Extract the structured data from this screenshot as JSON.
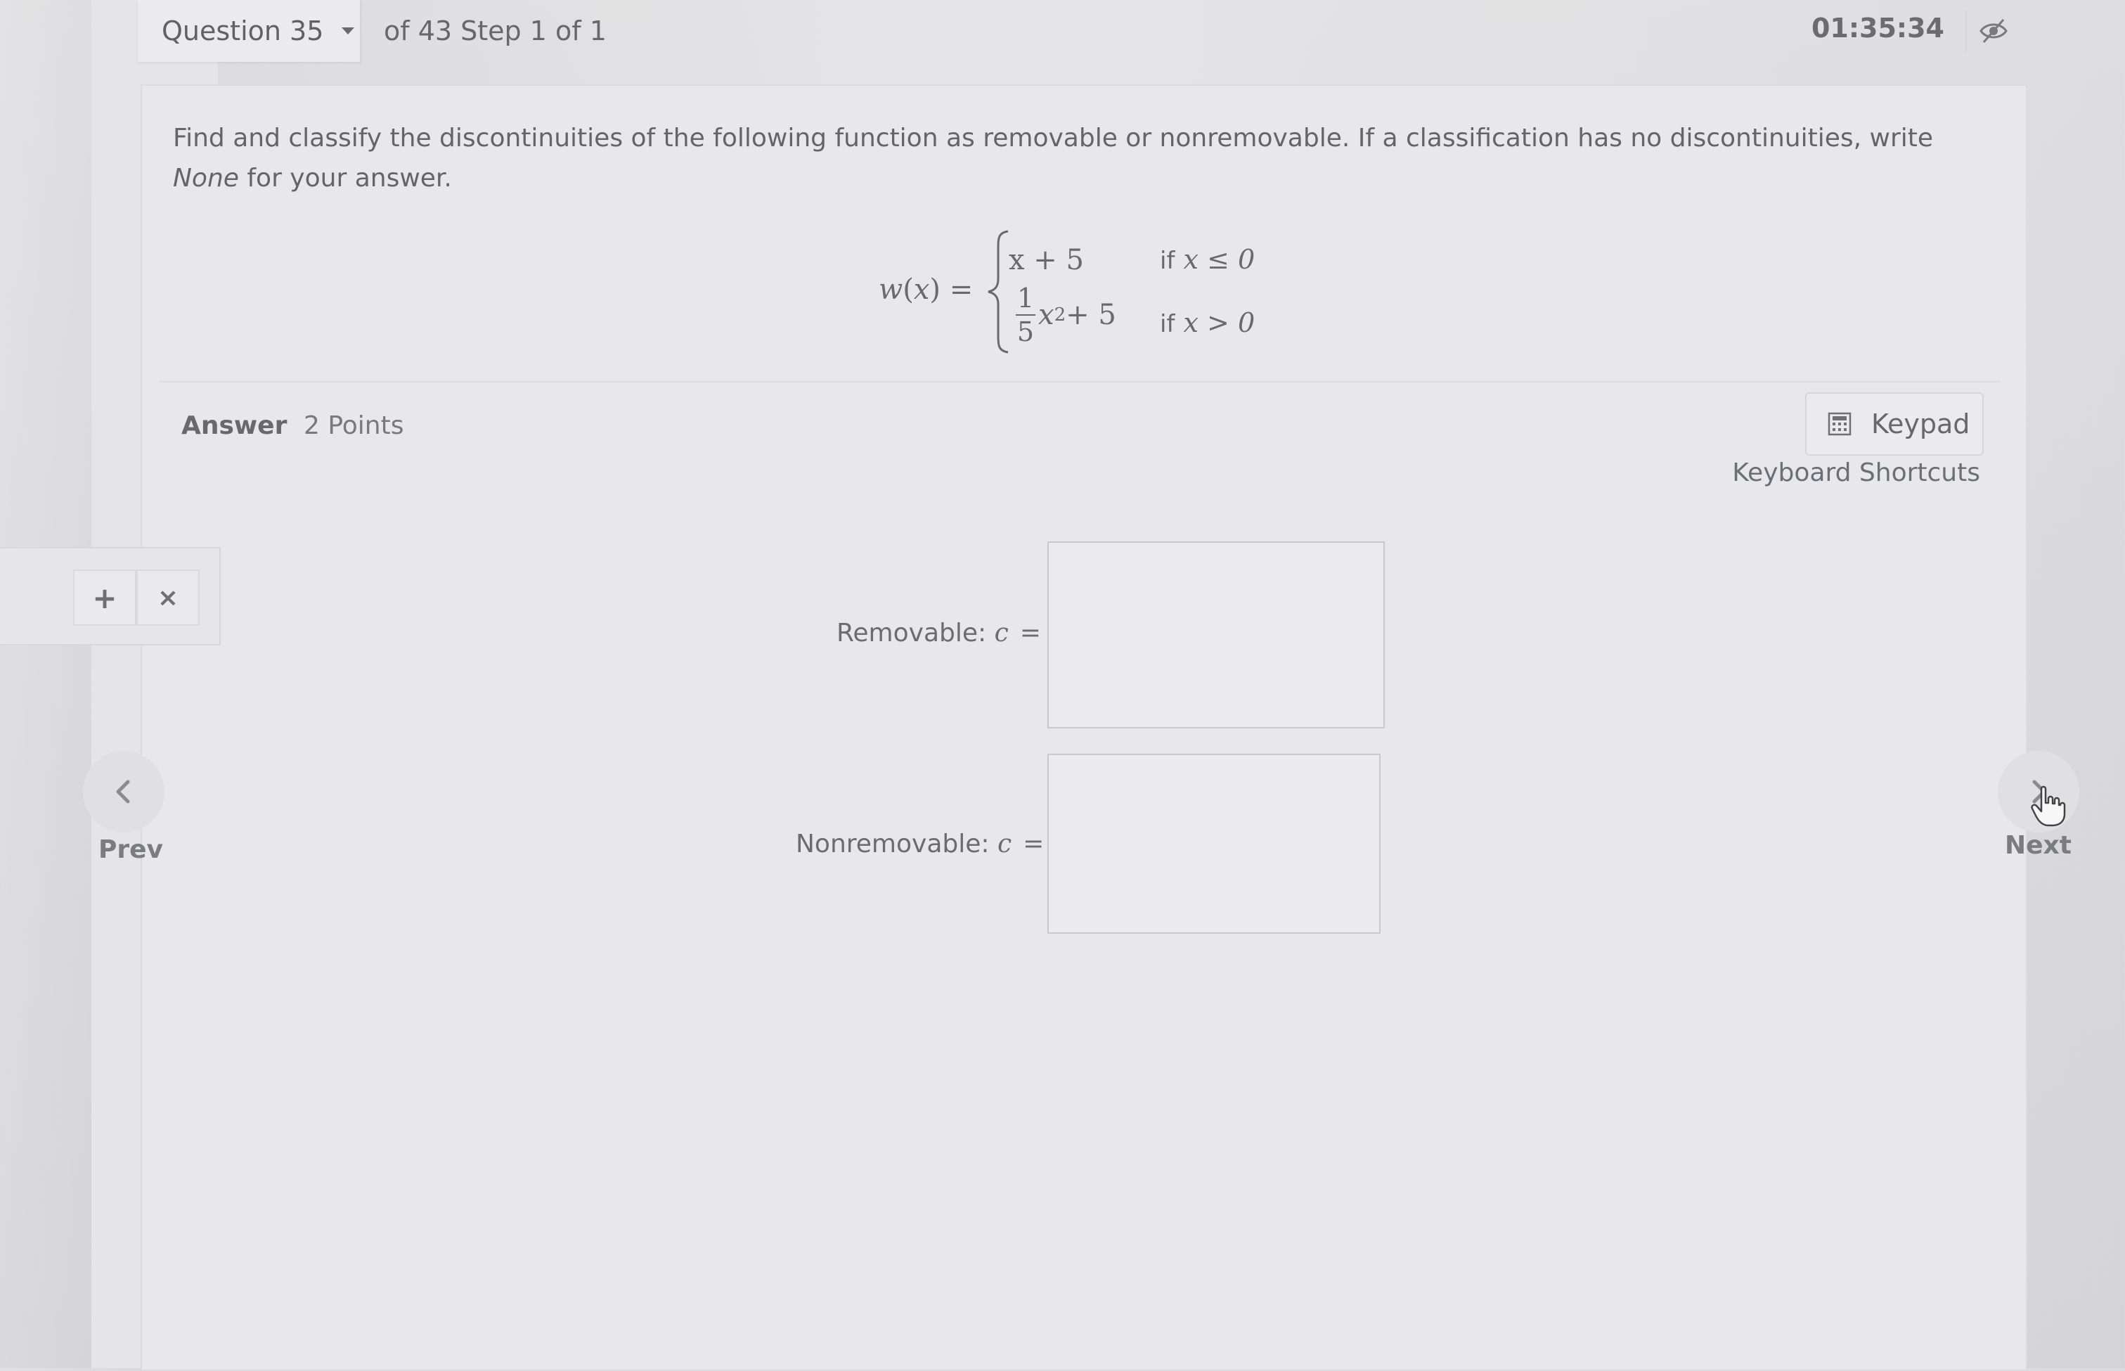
{
  "header": {
    "question_label": "Question 35",
    "step_text": "of 43 Step 1 of 1",
    "timer": "01:35:34",
    "visibility_icon": "eye-off-icon"
  },
  "prompt": {
    "text_before_none": "Find and classify the discontinuities of the following function as removable or nonremovable. If a classification has no discontinuities, write ",
    "none_word": "None",
    "text_after_none": " for your answer."
  },
  "equation": {
    "lhs_name": "w",
    "lhs_var": "x",
    "equals": "=",
    "case1_expr": "x + 5",
    "case1_if": "if",
    "case1_cond": "x ≤ 0",
    "case2_num": "1",
    "case2_den": "5",
    "case2_var": "x",
    "case2_exp": "2",
    "case2_rest": " + 5",
    "case2_if": "if",
    "case2_cond": "x > 0"
  },
  "answer": {
    "label": "Answer",
    "points": "2 Points",
    "keypad_label": "Keypad",
    "keyboard_shortcuts": "Keyboard Shortcuts",
    "removable_label": "Removable: ",
    "nonremovable_label": "Nonremovable: ",
    "var": "c",
    "equals": "=",
    "removable_value": "",
    "nonremovable_value": ""
  },
  "tools": {
    "plus_label": "+",
    "close_label": "×"
  },
  "nav": {
    "prev_label": "Prev",
    "next_label": "Next"
  }
}
